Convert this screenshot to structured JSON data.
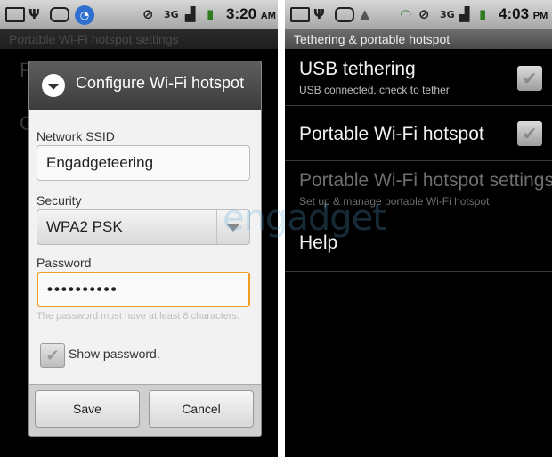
{
  "left_screen": {
    "status": {
      "icons": [
        "gmail-icon",
        "usb-icon",
        "android-icon",
        "wifi-hotspot-icon",
        "silent-icon",
        "3g-icon",
        "signal-icon",
        "battery-icon"
      ],
      "time": "3:20",
      "ampm": "AM"
    },
    "title": "Portable Wi-Fi hotspot settings",
    "dialog": {
      "title": "Configure Wi-Fi hotspot",
      "ssid_label": "Network SSID",
      "ssid_value": "Engadgeteering",
      "security_label": "Security",
      "security_value": "WPA2 PSK",
      "password_label": "Password",
      "password_value": "••••••••••",
      "hint": "The password must have at least 8 characters.",
      "show_password_label": "Show password.",
      "save_label": "Save",
      "cancel_label": "Cancel"
    }
  },
  "right_screen": {
    "status": {
      "icons": [
        "gmail-icon",
        "usb-icon",
        "android-icon",
        "navigation-icon",
        "wifi-hotspot-icon",
        "silent-icon",
        "3g-icon",
        "signal-icon",
        "battery-icon"
      ],
      "time": "4:03",
      "ampm": "PM"
    },
    "title": "Tethering & portable hotspot",
    "items": [
      {
        "title": "USB tethering",
        "subtitle": "USB connected, check to tether",
        "checked": true
      },
      {
        "title": "Portable Wi-Fi hotspot",
        "subtitle": "",
        "checked": true
      },
      {
        "title": "Portable Wi-Fi hotspot settings",
        "subtitle": "Set up & manage portable Wi-Fi hotspot"
      },
      {
        "title": "Help",
        "subtitle": ""
      }
    ]
  },
  "watermark": "engadget"
}
